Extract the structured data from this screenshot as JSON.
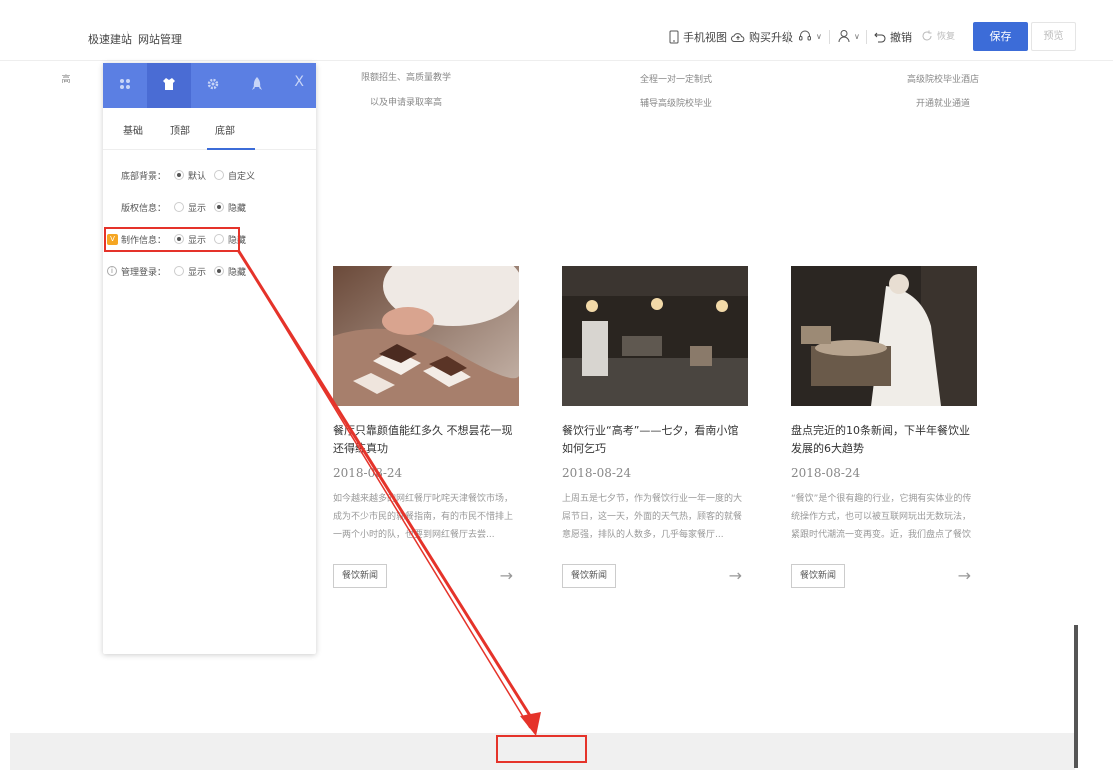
{
  "topbar": {
    "quick_build": "极速建站",
    "site_manage": "网站管理",
    "mobile_view": "手机视图",
    "upgrade": "购买升级",
    "undo": "撤销",
    "redo": "恢复",
    "save": "保存",
    "preview": "预览"
  },
  "features": {
    "col1_partial": "高",
    "col2_line1": "限额招生、高质量教学",
    "col2_line2": "以及申请录取率高",
    "col3_line1": "全程一对一定制式",
    "col3_line2": "辅导高级院校毕业",
    "col4_line1": "高级院校毕业酒店",
    "col4_line2": "开通就业通道"
  },
  "panel": {
    "icons": [
      "grid-icon",
      "shirt-icon",
      "gear-icon",
      "rocket-icon"
    ],
    "close": "X",
    "subtabs": [
      "基础",
      "顶部",
      "底部"
    ],
    "active_subtab": "底部",
    "options": [
      {
        "label": "底部背景：",
        "choices": [
          "默认",
          "自定义"
        ],
        "selected": 0
      },
      {
        "label": "版权信息：",
        "choices": [
          "显示",
          "隐藏"
        ],
        "selected": 1
      },
      {
        "label": "制作信息：",
        "choices": [
          "显示",
          "隐藏"
        ],
        "selected": 0
      },
      {
        "label": "管理登录：",
        "choices": [
          "显示",
          "隐藏"
        ],
        "selected": 1
      }
    ],
    "vip_badge": "V",
    "info_badge": "i"
  },
  "cards": [
    {
      "title": "餐厅只靠颜值能红多久 不想昙花一现还得练真功",
      "date": "2018-08-24",
      "desc": "如今越来越多的网红餐厅叱咤天津餐饮市场，成为不少市民的就餐指南，有的市民不惜排上一两个小时的队，也要到网红餐厅去尝...",
      "tag": "餐饮新闻",
      "arrow": "→"
    },
    {
      "title": "餐饮行业“高考”——七夕，看南小馆如何乞巧",
      "date": "2018-08-24",
      "desc": "上周五是七夕节，作为餐饮行业一年一度的大屌节日，这一天，外面的天气热，顾客的就餐意愿强，排队的人数多，几乎每家餐厅...",
      "tag": "餐饮新闻",
      "arrow": "→"
    },
    {
      "title": "盘点完近的10条新闻，下半年餐饮业发展的6大趋势",
      "date": "2018-08-24",
      "desc": "“餐饮”是个很有趣的行业，它拥有实体业的传统操作方式，也可以被互联网玩出无数玩法，紧跟时代潮流一变再变。近，我们盘点了餐饮大牌们...",
      "tag": "餐饮新闻",
      "arrow": "→"
    }
  ],
  "colors": {
    "accent": "#3c6cd8",
    "panel_header": "#5b7fe3",
    "annotation_red": "#e5332a"
  }
}
